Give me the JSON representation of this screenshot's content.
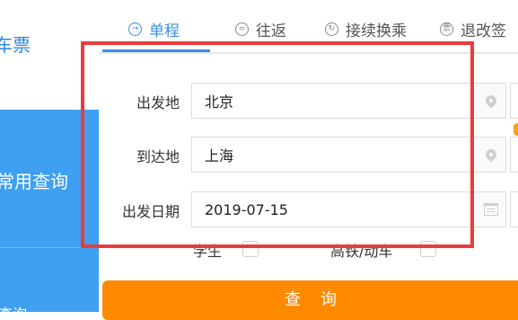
{
  "sidebar": {
    "top_label": "车票",
    "active_label": "常用查询",
    "next_label": "查询"
  },
  "tabs": [
    {
      "label": "单程",
      "icon": "arrow-circle-icon",
      "glyph": "→",
      "active": true
    },
    {
      "label": "往返",
      "icon": "equals-circle-icon",
      "glyph": "=",
      "active": false
    },
    {
      "label": "接续换乘",
      "icon": "transfer-circle-icon",
      "glyph": "↻",
      "active": false
    },
    {
      "label": "退改签",
      "icon": "ticket-circle-icon",
      "glyph": "票",
      "active": false
    }
  ],
  "form": {
    "from_label": "出发地",
    "from_value": "北京",
    "to_label": "到达地",
    "to_value": "上海",
    "date_label": "出发日期",
    "date_value": "2019-07-15",
    "student_label": "学生",
    "highspeed_label": "高铁/动车"
  },
  "query_button": "查询",
  "colors": {
    "accent": "#3a8ee6",
    "sidebar_active": "#3f9ff0",
    "highlight": "#ec3b3b",
    "button": "#ff8a00"
  }
}
